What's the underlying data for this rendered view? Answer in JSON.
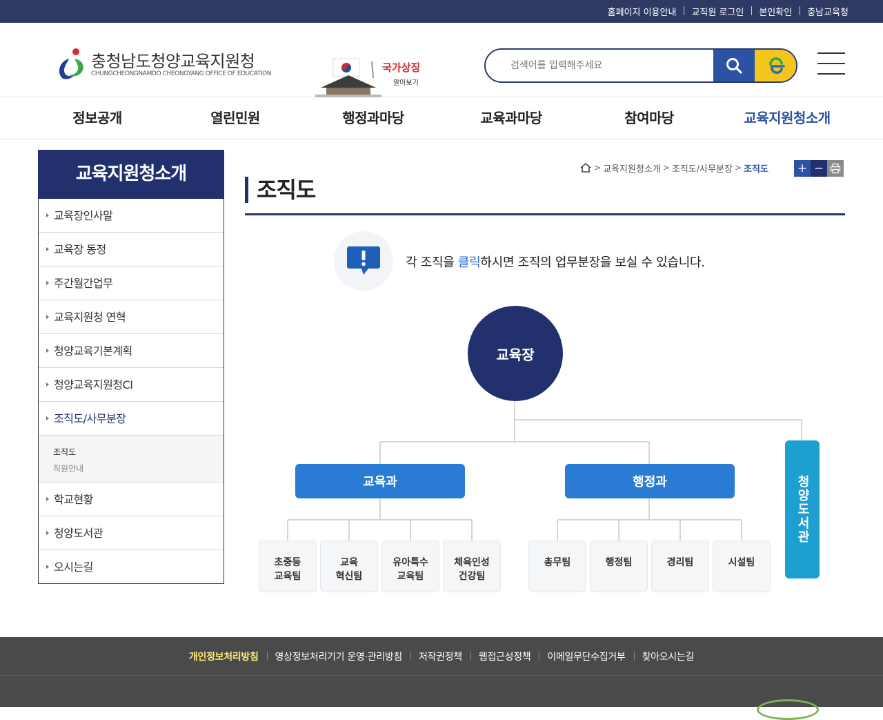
{
  "topbar": {
    "links": [
      "홈페이지 이용안내",
      "교직원 로그인",
      "본인확인",
      "충남교육청"
    ]
  },
  "header": {
    "logo_title": "충청남도청양교육지원청",
    "logo_sub": "CHUNGCHEONGNAMDO CHEONGYANG OFFICE OF EDUCATION",
    "symbol_text1": "국가상징",
    "symbol_text2": "알아보기",
    "search_placeholder": "검색어를 입력해주세요",
    "search_icon": "search-icon",
    "e_icon": "e-logo-icon",
    "menu_icon": "hamburger-icon"
  },
  "gnb": {
    "items": [
      "정보공개",
      "열린민원",
      "행정과마당",
      "교육과마당",
      "참여마당",
      "교육지원청소개"
    ],
    "active_index": 5
  },
  "lnb": {
    "title": "교육지원청소개",
    "items": [
      "교육장인사말",
      "교육장 동정",
      "주간월간업무",
      "교육지원청 연혁",
      "청양교육기본계획",
      "청양교육지원청CI",
      "조직도/사무분장",
      "학교현황",
      "청양도서관",
      "오시는길"
    ],
    "sub_items": [
      "조직도",
      "직원안내"
    ]
  },
  "breadcrumb": {
    "items": [
      "교육지원청소개",
      "조직도/사무분장",
      "조직도"
    ],
    "home_icon": "home-icon"
  },
  "font_tools": {
    "plus": "+",
    "minus": "−",
    "print_icon": "print-icon"
  },
  "page": {
    "title": "조직도",
    "notice_before": "각 조직을 ",
    "notice_highlight": "클릭",
    "notice_after": "하시면 조직의 업무분장을 보실 수 있습니다.",
    "notice_icon": "exclamation-bubble-icon"
  },
  "org": {
    "chief": "교육장",
    "dept_edu": "교육과",
    "dept_admin": "행정과",
    "library": "청양도서관",
    "edu_teams": [
      "초중등\n교육팀",
      "교육\n혁신팀",
      "유아특수\n교육팀",
      "체육인성\n건강팀"
    ],
    "admin_teams": [
      "총무팀",
      "행정팀",
      "경리팀",
      "시설팀"
    ]
  },
  "footer": {
    "links": [
      "개인정보처리방침",
      "영상정보처리기기 운영·관리방침",
      "저작권정책",
      "웹접근성정책",
      "이메일무단수집거부",
      "찾아오시는길"
    ]
  },
  "colors": {
    "navy": "#22306e",
    "topbar": "#2e3a63",
    "blue": "#2b52a3",
    "dept": "#2a7bd3",
    "library": "#1e9fd1",
    "yellow": "#f4c51c",
    "footer": "#4a4a4a"
  }
}
